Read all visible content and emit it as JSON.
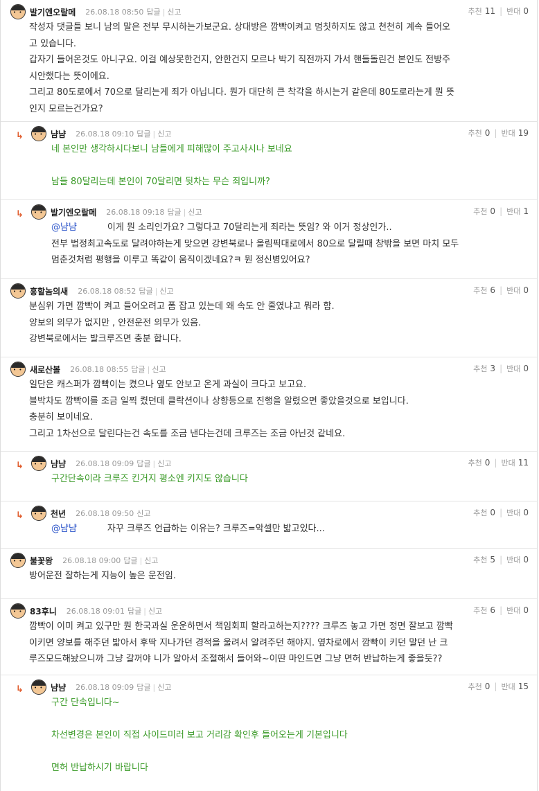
{
  "labels": {
    "reply": "답글",
    "report": "신고",
    "recommend": "추천",
    "oppose": "반대"
  },
  "comments": [
    {
      "nick": "발기엔오랄메",
      "date": "26.08.18 08:50",
      "up": "11",
      "down": "0",
      "lines": [
        "작성자 댓글들 보니 남의 말은 전부 무시하는가보군요. 상대방은 깜빡이켜고 멈칫하지도 않고 천천히 계속 들어오",
        "고 있습니다.",
        "갑자기 들어온것도 아니구요. 이걸 예상못한건지, 안한건지 모르나 박기 직전까지 가서 핸들돌린건 본인도 전방주",
        "시안했다는 뜻이에요.",
        "그리고 80도로에서 70으로 달리는게 죄가 아닙니다. 뭔가 대단히 큰 착각을 하시는거 같은데 80도로라는게 뭔 뜻",
        "인지 모르는건가요?"
      ]
    },
    {
      "nick": "냠냠",
      "date": "26.08.18 09:10",
      "up": "0",
      "down": "19",
      "lines": [
        "네 본인만 생각하시다보니 남들에게 피해많이 주고사시나 보네요",
        "",
        "남들 80달리는데 본인이 70달리면 뒷차는 무슨 죄입니까?"
      ]
    },
    {
      "nick": "발기엔오랄메",
      "date": "26.08.18 09:18",
      "up": "0",
      "down": "1",
      "mention": "@냠냠",
      "first_line": "이게 뭔 소리인가요? 그렇다고 70달리는게 죄라는 뜻임? 와 이거 정상인가..",
      "lines": [
        "전부 법정최고속도로 달려야하는게 맞으면 강변북로나 올림픽대로에서 80으로 달릴때 창밖을 보면 마치 모두",
        "멈춘것처럼 평행을 이루고 똑같이 움직이겠네요?ㅋ 뭔 정신병있어요?"
      ]
    },
    {
      "nick": "흥할놈의새",
      "date": "26.08.18 08:52",
      "up": "6",
      "down": "0",
      "lines": [
        "분심위 가면 깜빡이 켜고 들어오려고 폼 잡고 있는데 왜 속도 안 줄였냐고 뭐라 함.",
        "양보의 의무가 없지만 , 안전운전 의무가 있음.",
        "강변북로에서는 발크루즈면 충분 합니다."
      ]
    },
    {
      "nick": "새로산볼",
      "date": "26.08.18 08:55",
      "up": "3",
      "down": "0",
      "lines": [
        "일단은 캐스퍼가 깜빡이는 켰으나 옆도 안보고 온게 과실이 크다고 보고요.",
        "블박차도 깜빡이를 조금 일찍 켰던데 클락션이나 상향등으로 진행을 알렸으면 좋았을것으로 보입니다.",
        "충분히 보이네요.",
        "그리고 1차선으로 달린다는건 속도를 조금 낸다는건데 크루즈는 조금 아닌것 같네요."
      ]
    },
    {
      "nick": "냠냠",
      "date": "26.08.18 09:09",
      "up": "0",
      "down": "11",
      "lines": [
        "구간단속이라 크루즈 킨거지 평소엔 키지도 않습니다"
      ]
    },
    {
      "nick": "천년",
      "date": "26.08.18 09:50",
      "up": "0",
      "down": "0",
      "mention": "@냠냠",
      "first_line": "자꾸 크루즈 언급하는 이유는? 크루즈=악셀만 밟고있다...",
      "lines": []
    },
    {
      "nick": "불꽃왕",
      "date": "26.08.18 09:00",
      "up": "5",
      "down": "0",
      "lines": [
        "방어운전 잘하는게 지능이 높은 운전임."
      ]
    },
    {
      "nick": "83후니",
      "date": "26.08.18 09:01",
      "up": "6",
      "down": "0",
      "lines": [
        "깜빡이 이미 켜고 있구만 뭔 한국과실 운운하면서 책임회피 할라고하는지???? 크루즈 놓고 가면 정면 잘보고 깜빡",
        "이키면 양보를 해주던 밟아서 후딱 지나가던 경적을 울려서 알려주던 해야지. 옆차로에서 깜빡이 키던 말던 난 크",
        "루즈모드해놨으니까 그냥 갈꺼야 니가 알아서 조절해서 들어와~이딴 마인드면 그냥 면허 반납하는게 좋을듯??"
      ]
    },
    {
      "nick": "냠냠",
      "date": "26.08.18 09:09",
      "up": "0",
      "down": "15",
      "lines": [
        "구간 단속입니다~",
        "",
        "차선변경은 본인이 직접 사이드미러 보고 거리감 확인후 들어오는게 기본입니다",
        "",
        "면허 반납하시기 바랍니다"
      ]
    }
  ]
}
